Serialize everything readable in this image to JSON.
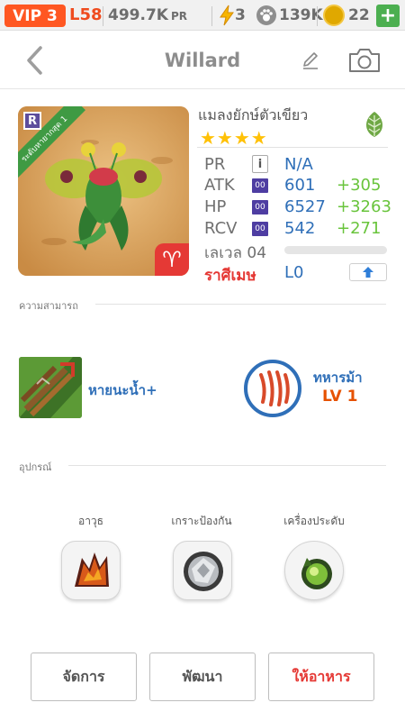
{
  "status_bar": {
    "vip": "VIP 3",
    "level": "L58",
    "power_value": "499.7K",
    "power_suffix": "PR",
    "energy": "3",
    "food": "139K",
    "coins": "22",
    "add_label": "+"
  },
  "header": {
    "title": "Willard"
  },
  "pet": {
    "name": "แมลงยักษ์ตัวเขียว",
    "rarity_letter": "R",
    "rarity_ribbon": "ระดับหายากสุด 1",
    "zodiac_symbol": "♈",
    "element_icon": "leaf-icon",
    "stars": "★★★★",
    "stars_count": 4,
    "stats": {
      "pr_label": "PR",
      "pr_value": "N/A",
      "info_glyph": "i",
      "badge_text": "00",
      "atk_label": "ATK",
      "atk_value": "601",
      "atk_bonus": "+305",
      "hp_label": "HP",
      "hp_value": "6527",
      "hp_bonus": "+3263",
      "rcv_label": "RCV",
      "rcv_value": "542",
      "rcv_bonus": "+271"
    },
    "level_label": "เลเวล 04",
    "level_progress": 0,
    "zodiac_label": "ราศีเมษ",
    "rank_value": "L0"
  },
  "abilities": {
    "section_title": "ความสามารถ",
    "skill1_label": "หายนะน้ำ+",
    "skill2_name": "ทหารม้า",
    "skill2_level": "LV 1"
  },
  "equipment": {
    "section_title": "อุปกรณ์",
    "slots": [
      {
        "label": "อาวุธ"
      },
      {
        "label": "เกราะป้องกัน"
      },
      {
        "label": "เครื่องประดับ"
      }
    ]
  },
  "actions": {
    "manage": "จัดการ",
    "develop": "พัฒนา",
    "feed": "ให้อาหาร"
  },
  "colors": {
    "vip": "#ff5722",
    "accent_blue": "#2f6fb8",
    "bonus_green": "#69c43c",
    "zodiac_red": "#e53935",
    "skill_level_orange": "#e65100",
    "star": "#ffc107"
  }
}
